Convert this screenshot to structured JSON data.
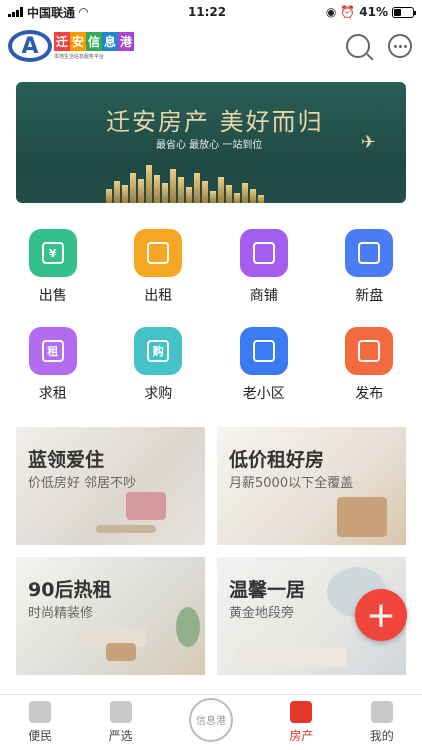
{
  "status": {
    "carrier": "中国联通",
    "time": "11:22",
    "battery": "41%"
  },
  "header": {
    "logo_letter": "A",
    "logo_chars": [
      "迁",
      "安",
      "信",
      "息",
      "港"
    ],
    "logo_tagline": "本地生活信息服务平台",
    "logo_colors": [
      "#e44",
      "#f90",
      "#3a5",
      "#28c",
      "#a4c"
    ]
  },
  "banner": {
    "title": "迁安房产 美好而归",
    "subtitle": "最省心 最放心 一站到位"
  },
  "grid": [
    {
      "label": "出售",
      "icon_char": "¥",
      "icon": "ticket-icon",
      "color": "#35c08b"
    },
    {
      "label": "出租",
      "icon_char": "",
      "icon": "suitcase-icon",
      "color": "#f5a623"
    },
    {
      "label": "商铺",
      "icon_char": "",
      "icon": "building-icon",
      "color": "#a55df0"
    },
    {
      "label": "新盘",
      "icon_char": "",
      "icon": "document-icon",
      "color": "#4a7cf5"
    },
    {
      "label": "求租",
      "icon_char": "租",
      "icon": "rent-icon",
      "color": "#b36cf0"
    },
    {
      "label": "求购",
      "icon_char": "购",
      "icon": "buy-icon",
      "color": "#43c3c8"
    },
    {
      "label": "老小区",
      "icon_char": "",
      "icon": "house-icon",
      "color": "#3b7af3"
    },
    {
      "label": "发布",
      "icon_char": "",
      "icon": "publish-icon",
      "color": "#f26a3d"
    }
  ],
  "cards": [
    {
      "title": "蓝领爱住",
      "subtitle": "价低房好 邻居不吵"
    },
    {
      "title": "低价租好房",
      "subtitle": "月薪5000以下全覆盖"
    },
    {
      "title": "90后热租",
      "subtitle": "时尚精装修"
    },
    {
      "title": "温馨一居",
      "subtitle": "黄金地段旁"
    }
  ],
  "fab": {
    "label": "+"
  },
  "tabbar": [
    {
      "label": "便民",
      "active": false
    },
    {
      "label": "严选",
      "active": false
    },
    {
      "label": "信息港",
      "center": true
    },
    {
      "label": "房产",
      "active": true
    },
    {
      "label": "我的",
      "active": false
    }
  ]
}
